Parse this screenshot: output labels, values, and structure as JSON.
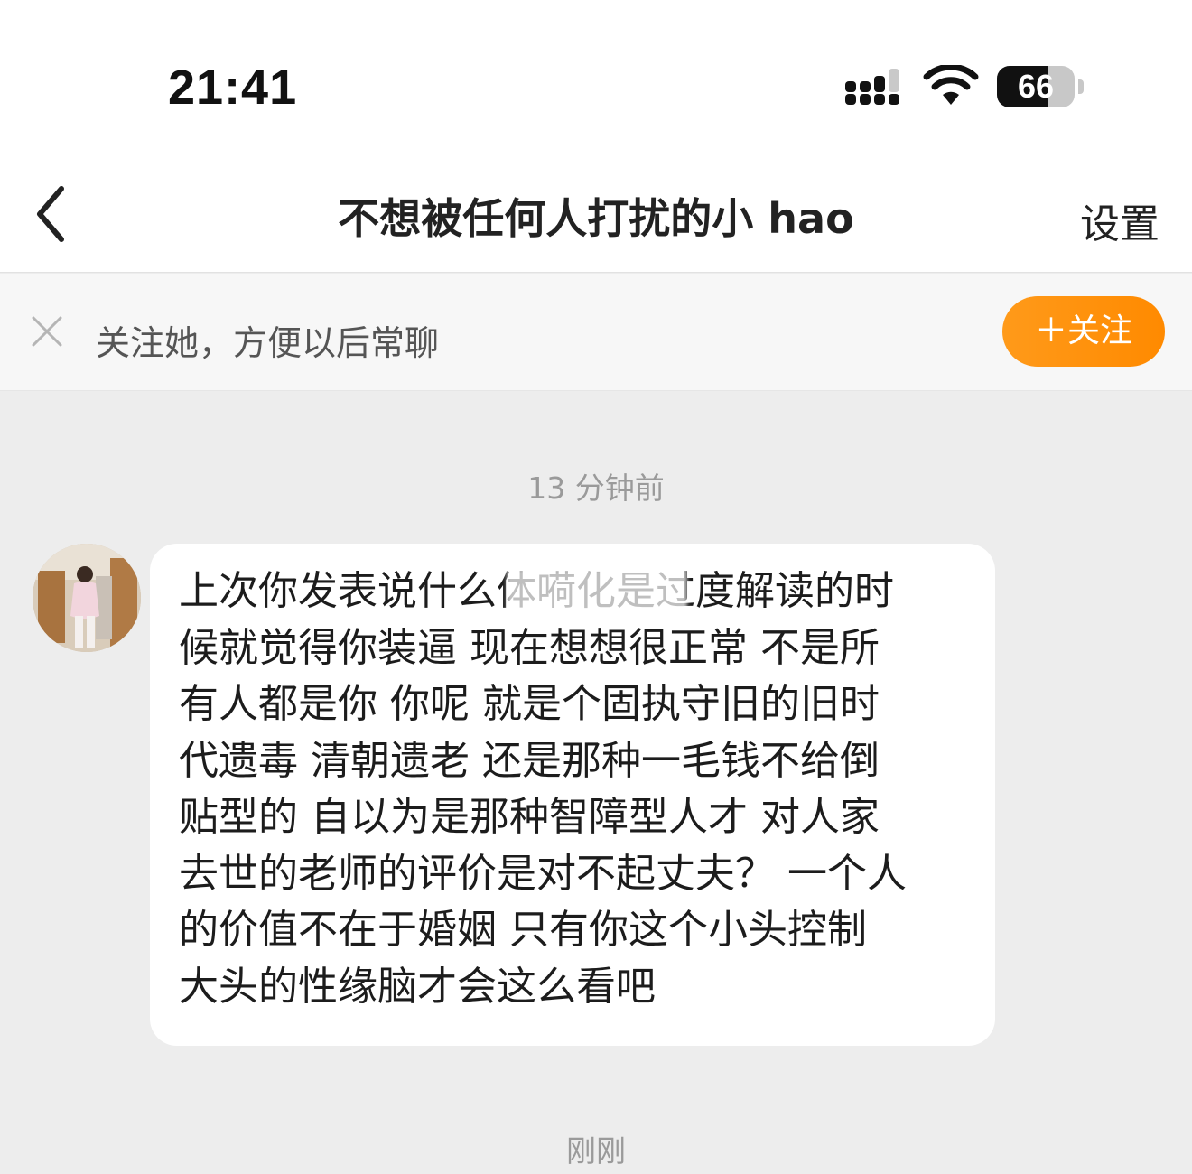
{
  "status_bar": {
    "time": "21:41",
    "battery_level": 66,
    "battery_text": "66",
    "icons": [
      "signal-icon",
      "wifi-icon",
      "battery-icon"
    ]
  },
  "nav": {
    "back_icon": "chevron-left-icon",
    "title": "不想被任何人打扰的小 hao",
    "settings_label": "设置"
  },
  "follow_banner": {
    "close_icon": "close-icon",
    "text": "关注她，方便以后常聊",
    "button_label": "＋关注",
    "accent": "#ff9500"
  },
  "chat": {
    "timestamp_1": "13 分钟前",
    "message": {
      "lines": [
        "上次你发表说什么体嗬化是过度解读的时",
        "候就觉得你装逼  现在想想很正常 不是所",
        "有人都是你  你呢 就是个固执守旧的旧时",
        "代遗毒 清朝遗老 还是那种一毛钱不给倒",
        "贴型的  自以为是那种智障型人才  对人家",
        "去世的老师的评价是对不起丈夫？ 一个人",
        "的价值不在于婚姻  只有你这个小头控制",
        "大头的性缘脑才会这么看吧"
      ]
    },
    "timestamp_2": "刚刚"
  }
}
